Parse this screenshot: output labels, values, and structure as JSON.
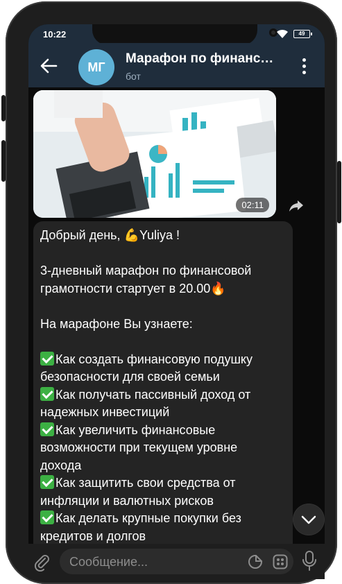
{
  "status_bar": {
    "time": "10:22",
    "battery": "49"
  },
  "header": {
    "avatar_initials": "МГ",
    "title": "Марафон по финанс…",
    "subtitle": "бот"
  },
  "video": {
    "duration": "02:11"
  },
  "message": {
    "lines": [
      {
        "text": "Добрый день, 💪Yuliya !"
      },
      {
        "text": ""
      },
      {
        "text": "3-дневный марафон по финансовой\nграмотности стартует в 20.00🔥"
      },
      {
        "text": ""
      },
      {
        "text": "На марафоне Вы узнаете:"
      },
      {
        "text": ""
      },
      {
        "check": true,
        "text": "Как создать финансовую подушку\nбезопасности для своей семьи"
      },
      {
        "check": true,
        "text": "Как получать пассивный доход от\nнадежных инвестиций"
      },
      {
        "check": true,
        "text": "Как увеличить финансовые\nвозможности при текущем уровне\nдохода"
      },
      {
        "check": true,
        "text": "Как защитить свои средства от\nинфляции и валютных рисков"
      },
      {
        "check": true,
        "text": "Как делать крупные покупки без\nкредитов и долгов"
      }
    ]
  },
  "composer": {
    "placeholder": "Сообщение..."
  },
  "colors": {
    "header_bg": "#1f2d3c",
    "avatar_bg": "#5eb1d6",
    "bubble_bg": "#242424",
    "check_green": "#3cb043"
  },
  "icons": [
    "back-arrow-icon",
    "more-vertical-icon",
    "share-icon",
    "chevron-down-icon",
    "paperclip-icon",
    "sticker-icon",
    "emoji-keyboard-icon",
    "microphone-icon",
    "wifi-icon",
    "battery-icon"
  ]
}
